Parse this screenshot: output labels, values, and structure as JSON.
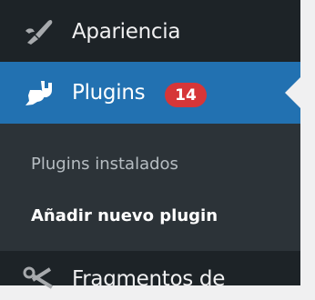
{
  "menu": {
    "items": [
      {
        "label": "Apariencia",
        "icon": "brush-icon"
      },
      {
        "label": "Plugins",
        "icon": "plugin-plug-icon",
        "badge": "14",
        "current": true
      },
      {
        "label": "Fragmentos de",
        "icon": "scissors-icon"
      }
    ],
    "submenu": [
      {
        "label": "Plugins instalados"
      },
      {
        "label": "Añadir nuevo plugin",
        "current": true
      }
    ]
  },
  "colors": {
    "menu_background": "#1d2327",
    "submenu_background": "#2c3338",
    "current_item_background": "#2271b1",
    "badge_background": "#d63638",
    "page_background": "#f0f0f1"
  }
}
